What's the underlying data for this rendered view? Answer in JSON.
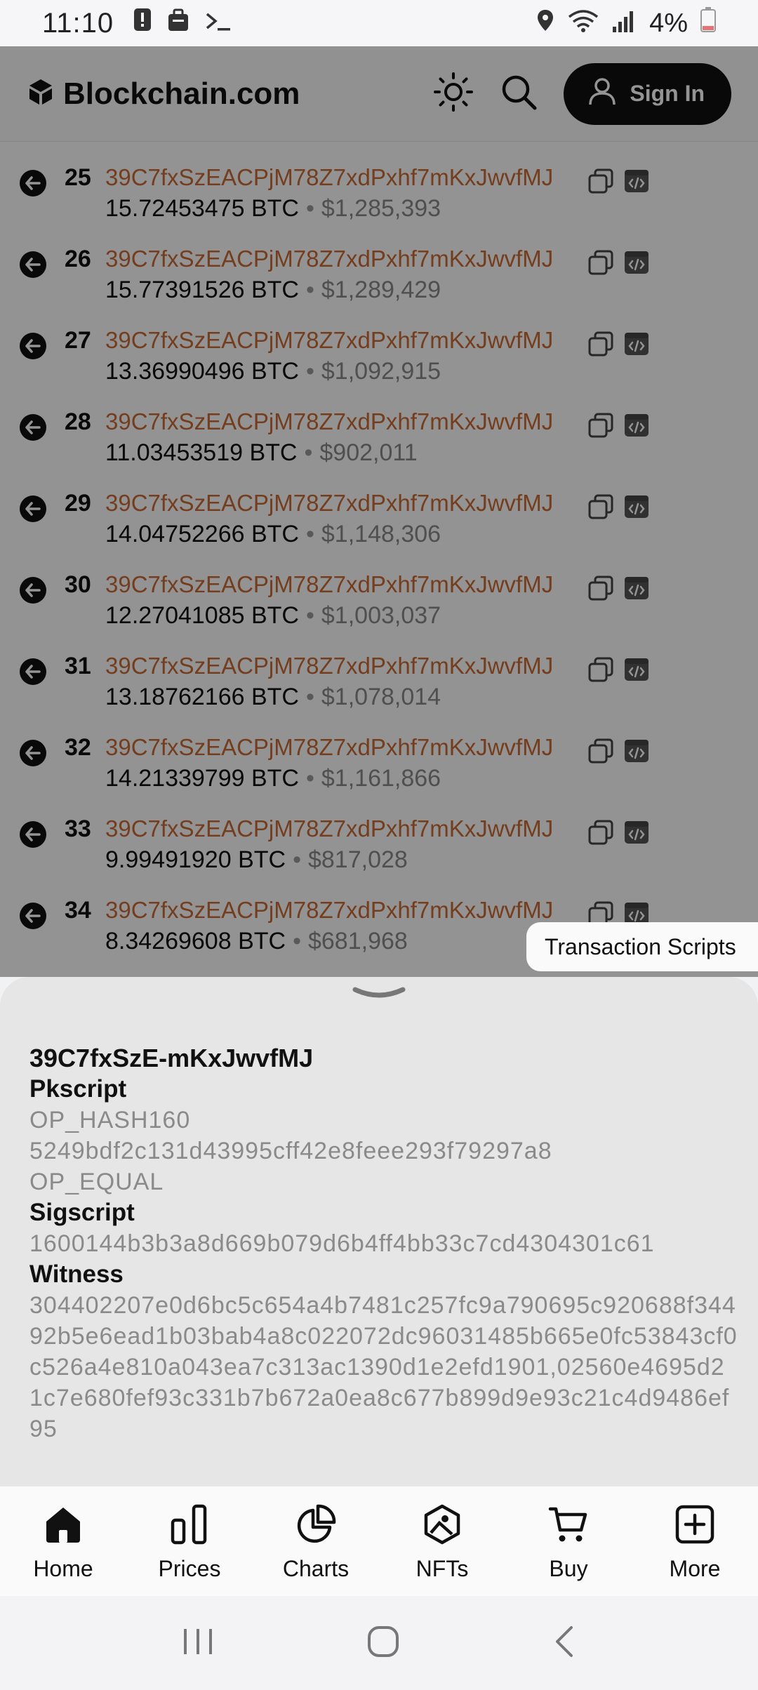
{
  "status_bar": {
    "time": "11:10",
    "battery_text": "4%",
    "left_icons": [
      "alert-icon",
      "briefcase-icon",
      "terminal-icon"
    ],
    "right_icons": [
      "location-icon",
      "wifi-icon",
      "signal-icon",
      "battery-icon"
    ]
  },
  "header": {
    "brand": "Blockchain.com",
    "sign_in_label": "Sign In",
    "icons": [
      "theme-toggle-icon",
      "search-icon",
      "user-icon"
    ]
  },
  "outputs": [
    {
      "index": "25",
      "address": "39C7fxSzEACPjM78Z7xdPxhf7mKxJwvfMJ",
      "btc": "15.72453475 BTC",
      "usd": "$1,285,393"
    },
    {
      "index": "26",
      "address": "39C7fxSzEACPjM78Z7xdPxhf7mKxJwvfMJ",
      "btc": "15.77391526 BTC",
      "usd": "$1,289,429"
    },
    {
      "index": "27",
      "address": "39C7fxSzEACPjM78Z7xdPxhf7mKxJwvfMJ",
      "btc": "13.36990496 BTC",
      "usd": "$1,092,915"
    },
    {
      "index": "28",
      "address": "39C7fxSzEACPjM78Z7xdPxhf7mKxJwvfMJ",
      "btc": "11.03453519 BTC",
      "usd": "$902,011"
    },
    {
      "index": "29",
      "address": "39C7fxSzEACPjM78Z7xdPxhf7mKxJwvfMJ",
      "btc": "14.04752266 BTC",
      "usd": "$1,148,306"
    },
    {
      "index": "30",
      "address": "39C7fxSzEACPjM78Z7xdPxhf7mKxJwvfMJ",
      "btc": "12.27041085 BTC",
      "usd": "$1,003,037"
    },
    {
      "index": "31",
      "address": "39C7fxSzEACPjM78Z7xdPxhf7mKxJwvfMJ",
      "btc": "13.18762166 BTC",
      "usd": "$1,078,014"
    },
    {
      "index": "32",
      "address": "39C7fxSzEACPjM78Z7xdPxhf7mKxJwvfMJ",
      "btc": "14.21339799 BTC",
      "usd": "$1,161,866"
    },
    {
      "index": "33",
      "address": "39C7fxSzEACPjM78Z7xdPxhf7mKxJwvfMJ",
      "btc": "9.99491920 BTC",
      "usd": "$817,028"
    },
    {
      "index": "34",
      "address": "39C7fxSzEACPjM78Z7xdPxhf7mKxJwvfMJ",
      "btc": "8.34269608 BTC",
      "usd": "$681,968"
    }
  ],
  "tooltip": "Transaction Scripts",
  "sheet": {
    "title": "39C7fxSzE-mKxJwvfMJ",
    "pkscript_label": "Pkscript",
    "pkscript_lines": [
      "OP_HASH160",
      "5249bdf2c131d43995cff42e8feee293f79297a8",
      "OP_EQUAL"
    ],
    "sigscript_label": "Sigscript",
    "sigscript": "1600144b3b3a8d669b079d6b4ff4bb33c7cd4304301c61",
    "witness_label": "Witness",
    "witness": "304402207e0d6bc5c654a4b7481c257fc9a790695c920688f34492b5e6ead1b03bab4a8c022072dc96031485b665e0fc53843cf0c526a4e810a043ea7c313ac1390d1e2efd1901,02560e4695d21c7e680fef93c331b7b672a0ea8c677b899d9e93c21c4d9486ef95"
  },
  "bottom_nav": [
    {
      "label": "Home",
      "icon": "home-icon"
    },
    {
      "label": "Prices",
      "icon": "bar-chart-icon"
    },
    {
      "label": "Charts",
      "icon": "pie-chart-icon"
    },
    {
      "label": "NFTs",
      "icon": "nft-icon"
    },
    {
      "label": "Buy",
      "icon": "cart-icon"
    },
    {
      "label": "More",
      "icon": "plus-square-icon"
    }
  ],
  "system_nav": [
    "recents-icon",
    "home-circle-icon",
    "back-icon"
  ],
  "colors": {
    "address": "#c96a35",
    "accent_dark": "#111111"
  }
}
